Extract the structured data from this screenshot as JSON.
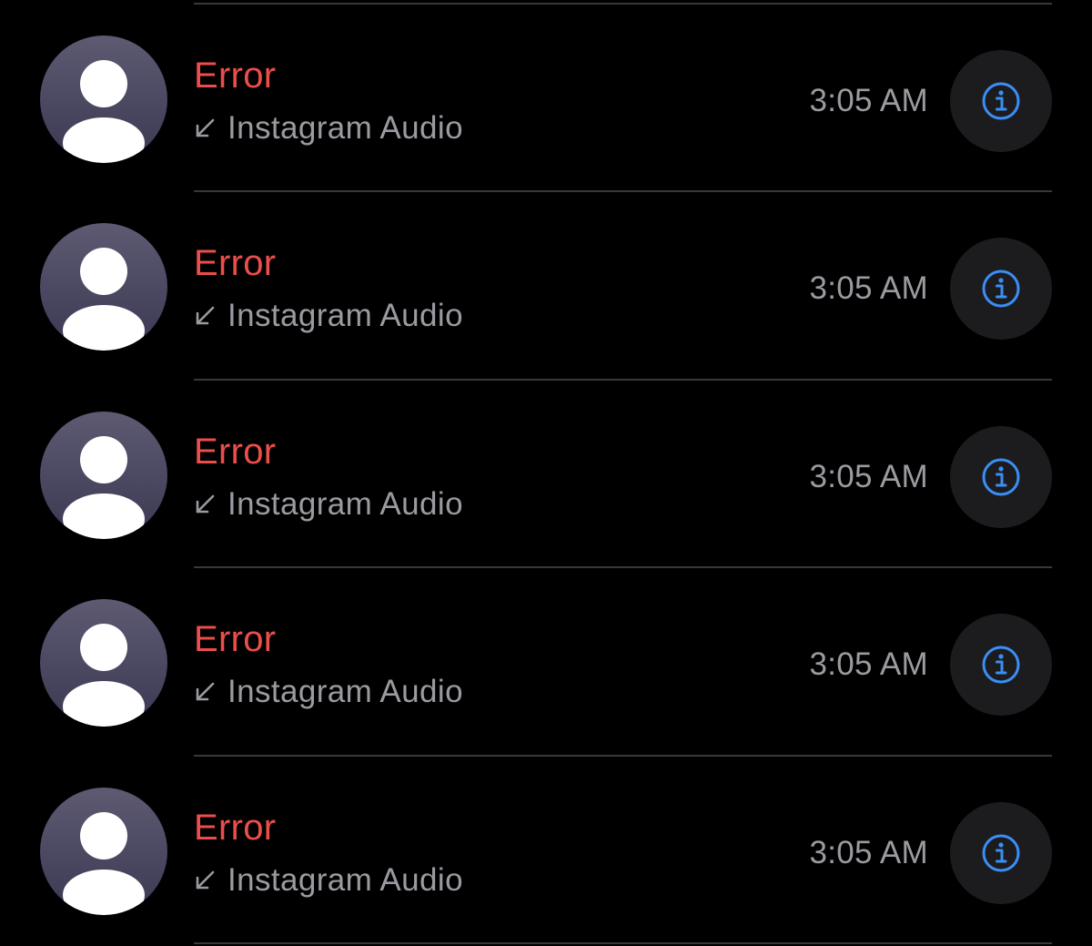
{
  "calls": [
    {
      "name": "Error",
      "type_label": "Instagram Audio",
      "time": "3:05 AM",
      "direction_icon": "arrow-down-left-icon",
      "info_icon": "info-circle-icon"
    },
    {
      "name": "Error",
      "type_label": "Instagram Audio",
      "time": "3:05 AM",
      "direction_icon": "arrow-down-left-icon",
      "info_icon": "info-circle-icon"
    },
    {
      "name": "Error",
      "type_label": "Instagram Audio",
      "time": "3:05 AM",
      "direction_icon": "arrow-down-left-icon",
      "info_icon": "info-circle-icon"
    },
    {
      "name": "Error",
      "type_label": "Instagram Audio",
      "time": "3:05 AM",
      "direction_icon": "arrow-down-left-icon",
      "info_icon": "info-circle-icon"
    },
    {
      "name": "Error",
      "type_label": "Instagram Audio",
      "time": "3:05 AM",
      "direction_icon": "arrow-down-left-icon",
      "info_icon": "info-circle-icon"
    }
  ],
  "colors": {
    "background": "#000000",
    "missed_call_name": "#eb4e4b",
    "secondary_text": "#9a9aa0",
    "accent_blue": "#3a8ef6",
    "info_button_bg": "#1c1c1e",
    "separator": "#38383a"
  }
}
